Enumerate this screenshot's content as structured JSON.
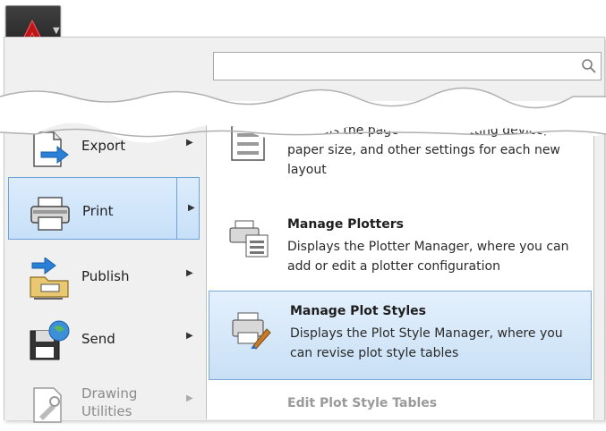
{
  "search": {
    "placeholder": ""
  },
  "menu": {
    "items": [
      {
        "label": "Export"
      },
      {
        "label": "Print"
      },
      {
        "label": "Publish"
      },
      {
        "label": "Send"
      },
      {
        "label": "Drawing Utilities"
      }
    ]
  },
  "submenu": {
    "page_setup": {
      "desc": "Controls the page layout, plotting device, paper size, and other settings for each new layout"
    },
    "manage_plotters": {
      "title": "Manage Plotters",
      "desc": "Displays the Plotter Manager, where you can add or edit a plotter configuration"
    },
    "manage_plot_styles": {
      "title": "Manage Plot Styles",
      "desc": "Displays the Plot Style Manager, where you can revise plot style tables"
    },
    "edit_plot_style_tables": {
      "title": "Edit Plot Style Tables"
    }
  },
  "colors": {
    "selection": "#c7e0f8",
    "selection_border": "#6ea3d9",
    "brand_red": "#c0141b"
  },
  "icons": [
    "autocad-logo-icon",
    "search-icon",
    "export-icon",
    "print-icon",
    "publish-icon",
    "send-icon",
    "drawing-utilities-icon",
    "page-setup-icon",
    "manage-plotters-icon",
    "manage-plot-styles-icon",
    "edit-plot-style-tables-icon"
  ]
}
